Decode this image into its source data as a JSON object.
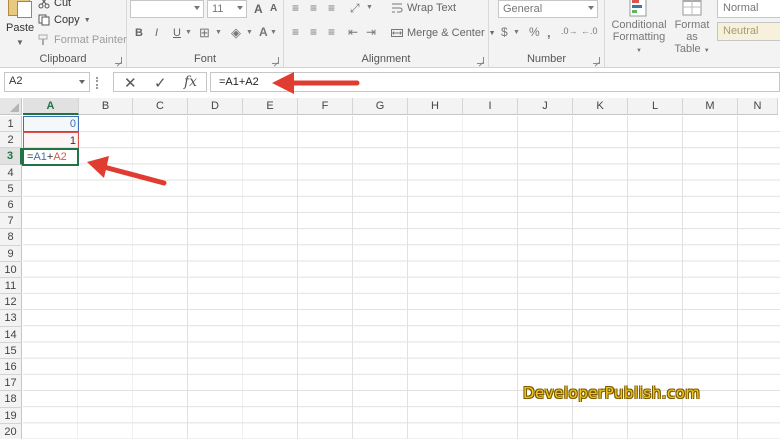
{
  "ribbon": {
    "clipboard": {
      "paste": "Paste",
      "cut": "Cut",
      "copy": "Copy",
      "format_painter": "Format Painter",
      "label": "Clipboard"
    },
    "font": {
      "font_name": "",
      "font_size": "11",
      "bold": "B",
      "italic": "I",
      "underline": "U",
      "grow": "A",
      "shrink": "A",
      "label": "Font"
    },
    "alignment": {
      "wrap_text": "Wrap Text",
      "merge_center": "Merge & Center",
      "label": "Alignment"
    },
    "number": {
      "format": "General",
      "label": "Number"
    },
    "styles": {
      "conditional_formatting_line1": "Conditional",
      "conditional_formatting_line2": "Formatting",
      "format_as_table_line1": "Format as",
      "format_as_table_line2": "Table",
      "normal": "Normal",
      "neutral": "Neutral"
    }
  },
  "formula_bar": {
    "name_box": "A2",
    "formula": "=A1+A2",
    "fx": "fx"
  },
  "sheet": {
    "columns": [
      "A",
      "B",
      "C",
      "D",
      "E",
      "F",
      "G",
      "H",
      "I",
      "J",
      "K",
      "L",
      "M",
      "N"
    ],
    "active_column": "A",
    "rows": [
      "1",
      "2",
      "3",
      "4",
      "5",
      "6",
      "7",
      "8",
      "9",
      "10",
      "11",
      "12",
      "13",
      "14",
      "15",
      "16",
      "17",
      "18",
      "19",
      "20"
    ],
    "active_row": "3",
    "cells": {
      "A1": "0",
      "A2": "1",
      "A3_eq": "=",
      "A3_ref1": "A1",
      "A3_plus": "+",
      "A3_ref2": "A2"
    }
  },
  "watermark": "DeveloperPublish.com",
  "colors": {
    "accent": "#217346",
    "ref1": "#3f6fb5",
    "ref2": "#d9534f",
    "arrow": "#e03c31"
  }
}
